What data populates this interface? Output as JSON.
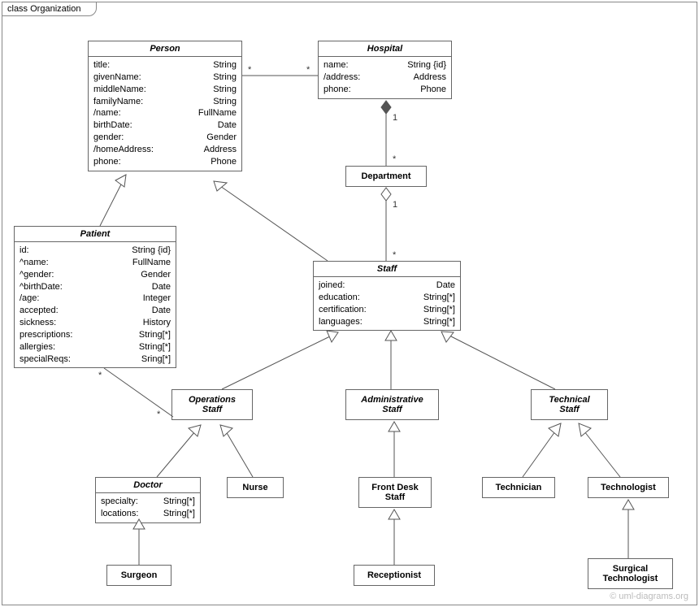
{
  "frame": {
    "title": "class Organization"
  },
  "watermark": "© uml-diagrams.org",
  "classes": {
    "person": {
      "name": "Person",
      "attrs": [
        {
          "n": "title:",
          "t": "String"
        },
        {
          "n": "givenName:",
          "t": "String"
        },
        {
          "n": "middleName:",
          "t": "String"
        },
        {
          "n": "familyName:",
          "t": "String"
        },
        {
          "n": "/name:",
          "t": "FullName"
        },
        {
          "n": "birthDate:",
          "t": "Date"
        },
        {
          "n": "gender:",
          "t": "Gender"
        },
        {
          "n": "/homeAddress:",
          "t": "Address"
        },
        {
          "n": "phone:",
          "t": "Phone"
        }
      ]
    },
    "hospital": {
      "name": "Hospital",
      "attrs": [
        {
          "n": "name:",
          "t": "String {id}"
        },
        {
          "n": "/address:",
          "t": "Address"
        },
        {
          "n": "phone:",
          "t": "Phone"
        }
      ]
    },
    "department": {
      "name": "Department"
    },
    "patient": {
      "name": "Patient",
      "attrs": [
        {
          "n": "id:",
          "t": "String {id}"
        },
        {
          "n": "^name:",
          "t": "FullName"
        },
        {
          "n": "^gender:",
          "t": "Gender"
        },
        {
          "n": "^birthDate:",
          "t": "Date"
        },
        {
          "n": "/age:",
          "t": "Integer"
        },
        {
          "n": "accepted:",
          "t": "Date"
        },
        {
          "n": "sickness:",
          "t": "History"
        },
        {
          "n": "prescriptions:",
          "t": "String[*]"
        },
        {
          "n": "allergies:",
          "t": "String[*]"
        },
        {
          "n": "specialReqs:",
          "t": "Sring[*]"
        }
      ]
    },
    "staff": {
      "name": "Staff",
      "attrs": [
        {
          "n": "joined:",
          "t": "Date"
        },
        {
          "n": "education:",
          "t": "String[*]"
        },
        {
          "n": "certification:",
          "t": "String[*]"
        },
        {
          "n": "languages:",
          "t": "String[*]"
        }
      ]
    },
    "opsStaff": {
      "name": "Operations",
      "name2": "Staff"
    },
    "adminStaff": {
      "name": "Administrative",
      "name2": "Staff"
    },
    "techStaff": {
      "name": "Technical",
      "name2": "Staff"
    },
    "doctor": {
      "name": "Doctor",
      "attrs": [
        {
          "n": "specialty:",
          "t": "String[*]"
        },
        {
          "n": "locations:",
          "t": "String[*]"
        }
      ]
    },
    "nurse": {
      "name": "Nurse"
    },
    "frontDesk": {
      "name": "Front Desk",
      "name2": "Staff"
    },
    "technician": {
      "name": "Technician"
    },
    "technologist": {
      "name": "Technologist"
    },
    "surgeon": {
      "name": "Surgeon"
    },
    "receptionist": {
      "name": "Receptionist"
    },
    "surgTech": {
      "name": "Surgical",
      "name2": "Technologist"
    }
  },
  "mult": {
    "star": "*",
    "one": "1"
  }
}
